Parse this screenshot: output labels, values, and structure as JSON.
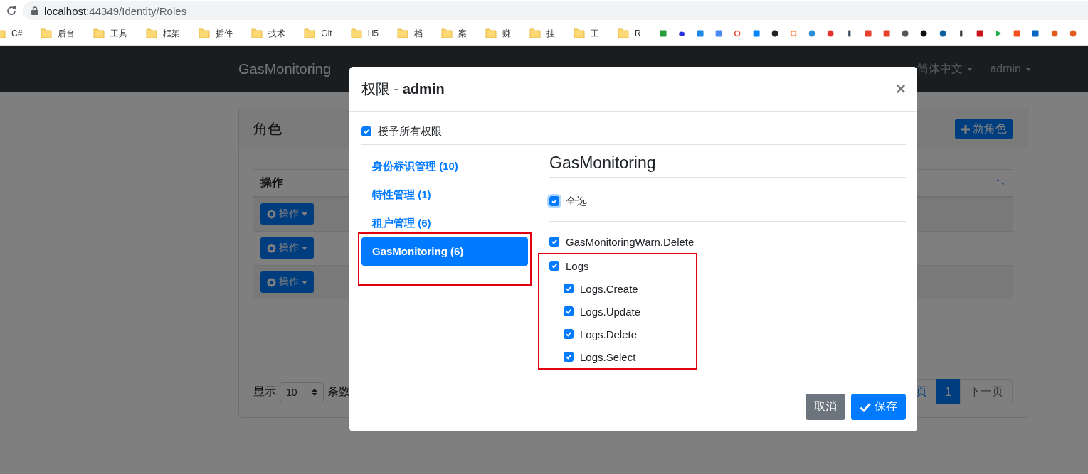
{
  "browser": {
    "url_host": "localhost",
    "url_rest": ":44349/Identity/Roles"
  },
  "bookmarks": [
    {
      "label": "C#"
    },
    {
      "label": "后台"
    },
    {
      "label": "工具"
    },
    {
      "label": "框架"
    },
    {
      "label": "插件"
    },
    {
      "label": "技术"
    },
    {
      "label": "Git"
    },
    {
      "label": "H5"
    },
    {
      "label": "档"
    },
    {
      "label": "案"
    },
    {
      "label": "赚"
    },
    {
      "label": "挂"
    },
    {
      "label": "工"
    },
    {
      "label": "R"
    }
  ],
  "navbar": {
    "brand": "GasMonitoring",
    "language": "简体中文",
    "user": "admin"
  },
  "card": {
    "title": "角色",
    "new_button": "新角色",
    "table": {
      "columns": [
        {
          "label": "操作",
          "sort": "↑↓"
        }
      ],
      "rows": [
        {
          "action": "操作"
        },
        {
          "action": "操作"
        },
        {
          "action": "操作"
        }
      ]
    },
    "footer": {
      "show_label": "显示",
      "page_size": "10",
      "count_label": "条数"
    },
    "pagination": [
      {
        "label": "页",
        "selected": false
      },
      {
        "label": "1",
        "selected": true
      },
      {
        "label": "下一页",
        "selected": false
      }
    ]
  },
  "modal": {
    "title": "权限 - **admin**",
    "close": "×",
    "grant_all": {
      "label": "授予所有权限",
      "checked": true
    },
    "groups": [
      {
        "label": "身份标识管理 (10)",
        "selected": false,
        "highlighted": false
      },
      {
        "label": "特性管理 (1)",
        "selected": false,
        "highlighted": false
      },
      {
        "label": "租户管理 (6)",
        "selected": false,
        "highlighted": false
      },
      {
        "label": "GasMonitoring (6)",
        "selected": true,
        "highlighted": true
      }
    ],
    "section_title": "GasMonitoring",
    "select_all": {
      "label": "全选",
      "checked": true
    },
    "permissions": [
      {
        "label": "GasMonitoringWarn.Delete",
        "checked": true,
        "highlighted": false
      },
      {
        "label": "Logs",
        "checked": true,
        "highlighted": true,
        "children": [
          {
            "label": "Logs.Create",
            "checked": true
          },
          {
            "label": "Logs.Update",
            "checked": true
          },
          {
            "label": "Logs.Delete",
            "checked": true
          },
          {
            "label": "Logs.Select",
            "checked": true
          }
        ]
      }
    ],
    "buttons": [
      {
        "label": "取消",
        "kind": "secondary"
      },
      {
        "label": "保存",
        "kind": "primary"
      }
    ]
  }
}
